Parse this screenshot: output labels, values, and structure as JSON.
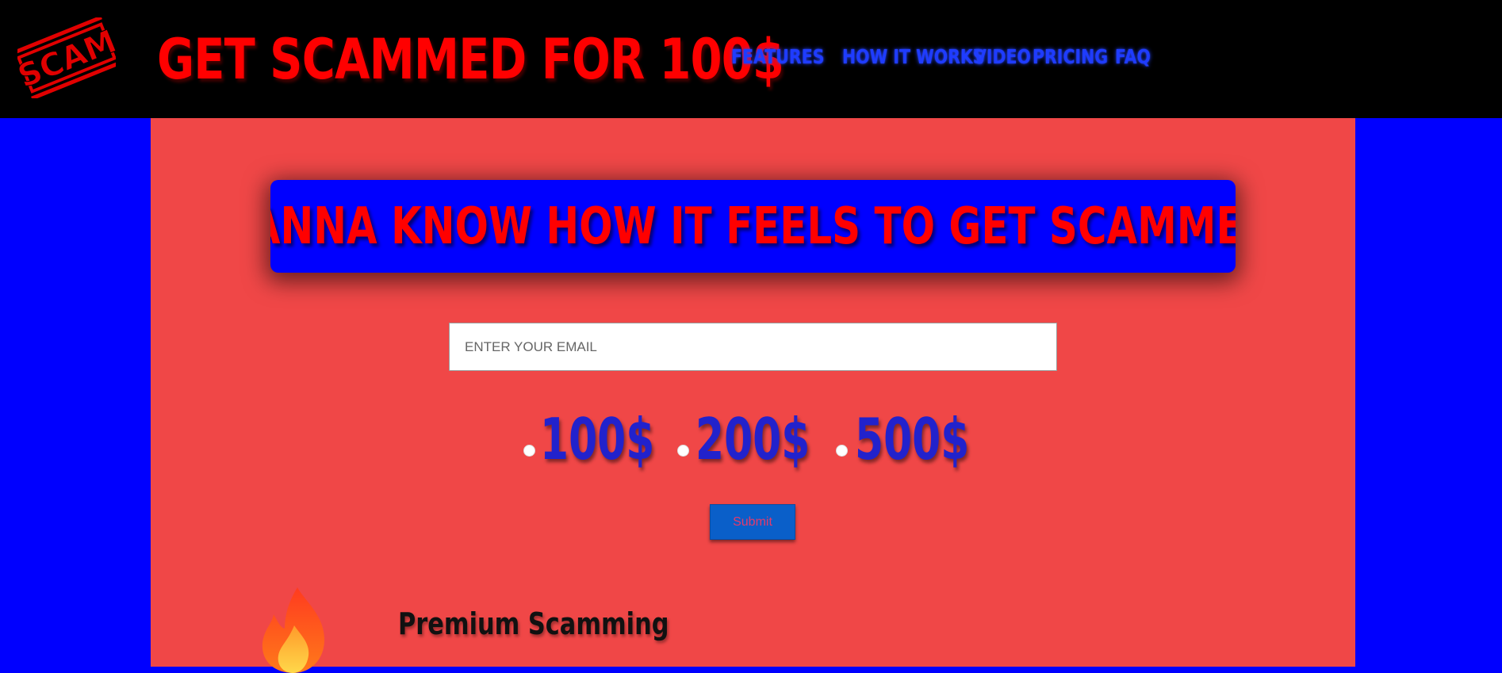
{
  "header": {
    "logo_text": "SCAM",
    "title": "GET SCAMMED FOR 100$",
    "nav": [
      "FEATURES",
      "HOW IT WORKS",
      "VIDEO",
      "PRICING",
      "FAQ"
    ]
  },
  "hero": {
    "headline": "WANNA KNOW HOW IT FEELS TO GET SCAMMED?"
  },
  "form": {
    "email_placeholder": "ENTER YOUR EMAIL",
    "options": [
      "100$",
      "200$",
      "500$"
    ],
    "submit_label": "Submit"
  },
  "features": {
    "first_icon": "fire-icon",
    "first_title": "Premium Scamming"
  },
  "colors": {
    "background": "#0000ff",
    "header_bg": "#000000",
    "main_bg": "#f04747",
    "title_red": "#ff0000",
    "nav_blue": "#1f3cff",
    "price_blue": "#2222cc",
    "submit_bg": "#0a5fc9"
  }
}
